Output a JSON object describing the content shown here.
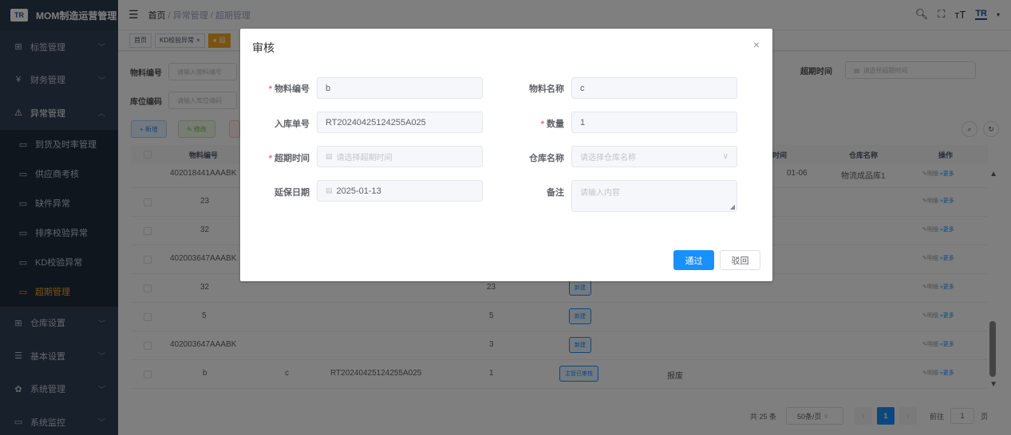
{
  "app": {
    "logo": "TR",
    "title": "MOM制造运营管理"
  },
  "sidebar": {
    "items": [
      {
        "label": "标签管理",
        "icon": "grid-icon"
      },
      {
        "label": "财务管理",
        "icon": "yen-icon"
      },
      {
        "label": "异常管理",
        "icon": "alert-icon"
      },
      {
        "label": "到货及时率管理",
        "icon": "monitor-icon"
      },
      {
        "label": "供应商考核",
        "icon": "monitor-icon"
      },
      {
        "label": "缺件异常",
        "icon": "monitor-icon"
      },
      {
        "label": "排序校验异常",
        "icon": "monitor-icon"
      },
      {
        "label": "KD校验异常",
        "icon": "monitor-icon"
      },
      {
        "label": "超期管理",
        "icon": "monitor-icon"
      },
      {
        "label": "仓库设置",
        "icon": "grid-icon"
      },
      {
        "label": "基本设置",
        "icon": "list-icon"
      },
      {
        "label": "系统管理",
        "icon": "gear-icon"
      },
      {
        "label": "系统监控",
        "icon": "monitor-icon"
      }
    ]
  },
  "breadcrumb": [
    "首页",
    "异常管理",
    "超期管理"
  ],
  "tags": [
    {
      "label": "首页"
    },
    {
      "label": "KD校验异常"
    },
    {
      "label": "超"
    }
  ],
  "search": {
    "material_code_label": "物料编号",
    "material_code_placeholder": "请输入物料编号",
    "location_code_label": "库位编码",
    "location_code_placeholder": "请输入库位编码",
    "overdue_time_label": "超期时间",
    "overdue_time_placeholder": "请选择超期时间"
  },
  "actions": {
    "add": "+ 新增",
    "edit": "修改"
  },
  "table": {
    "columns": {
      "material_code": "物料编号",
      "time": "时间",
      "warehouse": "仓库名称",
      "ops": "操作"
    },
    "rows": [
      {
        "code": "402018441AAABK",
        "name": "",
        "order": "",
        "qty": "",
        "status": "",
        "remark": "",
        "time": "01-06",
        "warehouse": "物流成品库1"
      },
      {
        "code": "23",
        "name": "",
        "order": "",
        "qty": "",
        "status": "",
        "remark": "",
        "time": "",
        "warehouse": ""
      },
      {
        "code": "32",
        "name": "",
        "order": "",
        "qty": "",
        "status": "",
        "remark": "",
        "time": "",
        "warehouse": ""
      },
      {
        "code": "402003647AAABK",
        "name": "",
        "order": "",
        "qty": "",
        "status": "",
        "remark": "",
        "time": "",
        "warehouse": ""
      },
      {
        "code": "32",
        "name": "",
        "order": "",
        "qty": "23",
        "status": "新建",
        "remark": "",
        "time": "",
        "warehouse": ""
      },
      {
        "code": "5",
        "name": "",
        "order": "",
        "qty": "5",
        "status": "新建",
        "remark": "",
        "time": "",
        "warehouse": ""
      },
      {
        "code": "402003647AAABK",
        "name": "",
        "order": "",
        "qty": "3",
        "status": "新建",
        "remark": "",
        "time": "",
        "warehouse": ""
      },
      {
        "code": "b",
        "name": "c",
        "order": "RT20240425124255A025",
        "qty": "1",
        "status": "主管已审核",
        "remark": "报废",
        "time": "",
        "warehouse": ""
      }
    ],
    "op_detail": "明细",
    "op_more": "更多"
  },
  "pagination": {
    "total": "共 25 条",
    "page_size": "50条/页",
    "current": "1",
    "goto_prefix": "前往",
    "goto_value": "1",
    "goto_suffix": "页"
  },
  "dialog": {
    "title": "审核",
    "fields": {
      "material_code": {
        "label": "物料编号",
        "value": "b",
        "required": true
      },
      "material_name": {
        "label": "物料名称",
        "value": "c"
      },
      "inbound_order": {
        "label": "入库单号",
        "value": "RT20240425124255A025"
      },
      "quantity": {
        "label": "数量",
        "value": "1",
        "required": true
      },
      "overdue_time": {
        "label": "超期时间",
        "placeholder": "请选择超期时间",
        "required": true
      },
      "warehouse_name": {
        "label": "仓库名称",
        "placeholder": "请选择仓库名称"
      },
      "extend_date": {
        "label": "延保日期",
        "value": "2025-01-13"
      },
      "remark": {
        "label": "备注",
        "placeholder": "请输入内容"
      }
    },
    "pass_label": "通过",
    "reject_label": "驳回"
  },
  "colors": {
    "primary": "#1890ff",
    "active_menu": "#f5a623",
    "sidebar_bg": "#304156",
    "required": "#f56c6c"
  }
}
